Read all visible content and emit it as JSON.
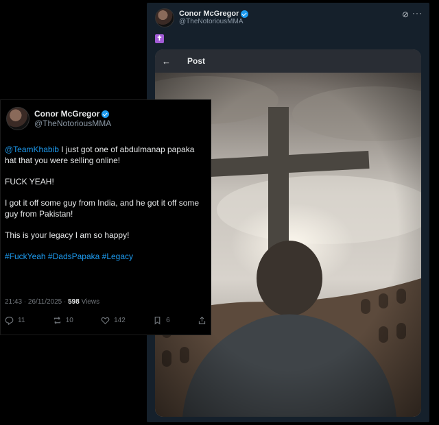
{
  "back_tweet": {
    "author_name": "Conor McGregor",
    "author_handle": "@TheNotoriousMMA",
    "emoji": "✝",
    "media_bar": {
      "back_glyph": "←",
      "title": "Post"
    }
  },
  "front_tweet": {
    "author_name": "Conor McGregor",
    "author_handle": "@TheNotoriousMMA",
    "mention": "@TeamKhabib",
    "line1_rest": " I just got one of abdulmanap papaka hat that you were selling online!",
    "line2": "FUCK YEAH!",
    "line3": "I got it off some guy from India, and he got it off some guy from Pakistan!",
    "line4": "This is your legacy I am so happy!",
    "hashtags": "#FuckYeah #DadsPapaka #Legacy",
    "timestamp": "21:43 · 26/11/2025 · ",
    "views_count": "598",
    "views_label": " Views",
    "actions": {
      "replies": "11",
      "reposts": "10",
      "likes": "142",
      "bookmarks": "6"
    }
  }
}
